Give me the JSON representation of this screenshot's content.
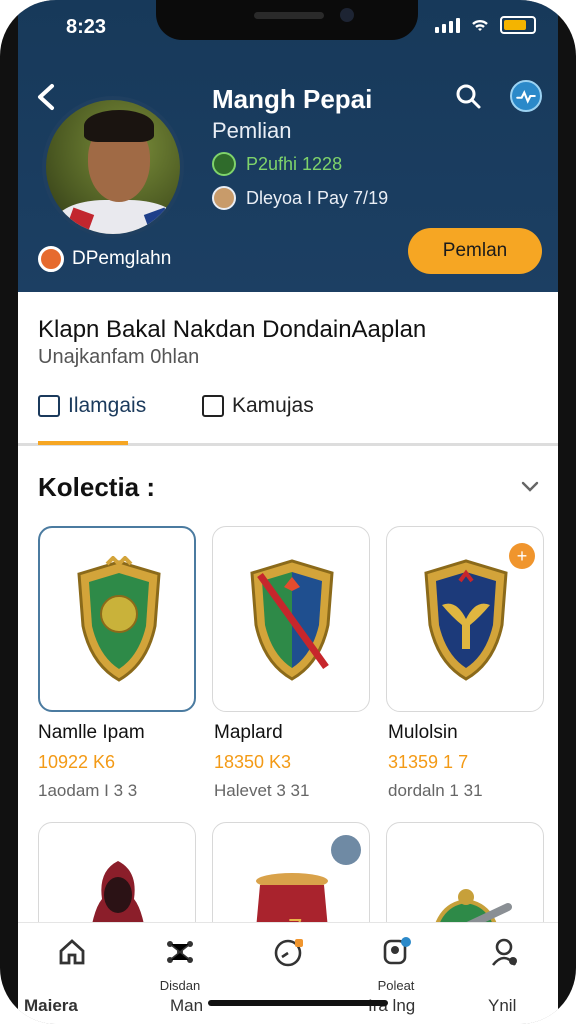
{
  "status_bar": {
    "time": "8:23"
  },
  "profile": {
    "name": "Mangh Pepai",
    "subtitle": "Pemlian",
    "meta1": "P2ufhi 1228",
    "meta2": "Dleyoa I Pay 7/19",
    "club": "DPemglahn",
    "cta_label": "Pemlan"
  },
  "page": {
    "title": "Klapn Bakal Nakdan DondainAaplan",
    "subtitle": "Unajkanfam 0hlan"
  },
  "tabs": [
    {
      "label": "Ilamgais"
    },
    {
      "label": "Kamujas"
    }
  ],
  "section": {
    "title": "Kolectia :"
  },
  "items": [
    {
      "name": "Namlle Ipam",
      "value": "10922 K6",
      "sub": "1aodam I 3 3"
    },
    {
      "name": "Maplard",
      "value": "18350 K3",
      "sub": "Halevet 3 31"
    },
    {
      "name": "Mulolsin",
      "value": "31359 1 7",
      "sub": "dordaln 1 31"
    }
  ],
  "bottom_nav": [
    {
      "label": ""
    },
    {
      "label": "Disdan"
    },
    {
      "label": ""
    },
    {
      "label": "Poleat"
    },
    {
      "label": ""
    }
  ],
  "bottom_labels": {
    "a": "Maiera",
    "b": "Man",
    "c": "Ira lng",
    "d": "Ynil"
  },
  "colors": {
    "header_bg": "#1c3f63",
    "accent": "#f6a623",
    "value": "#f39a16"
  }
}
